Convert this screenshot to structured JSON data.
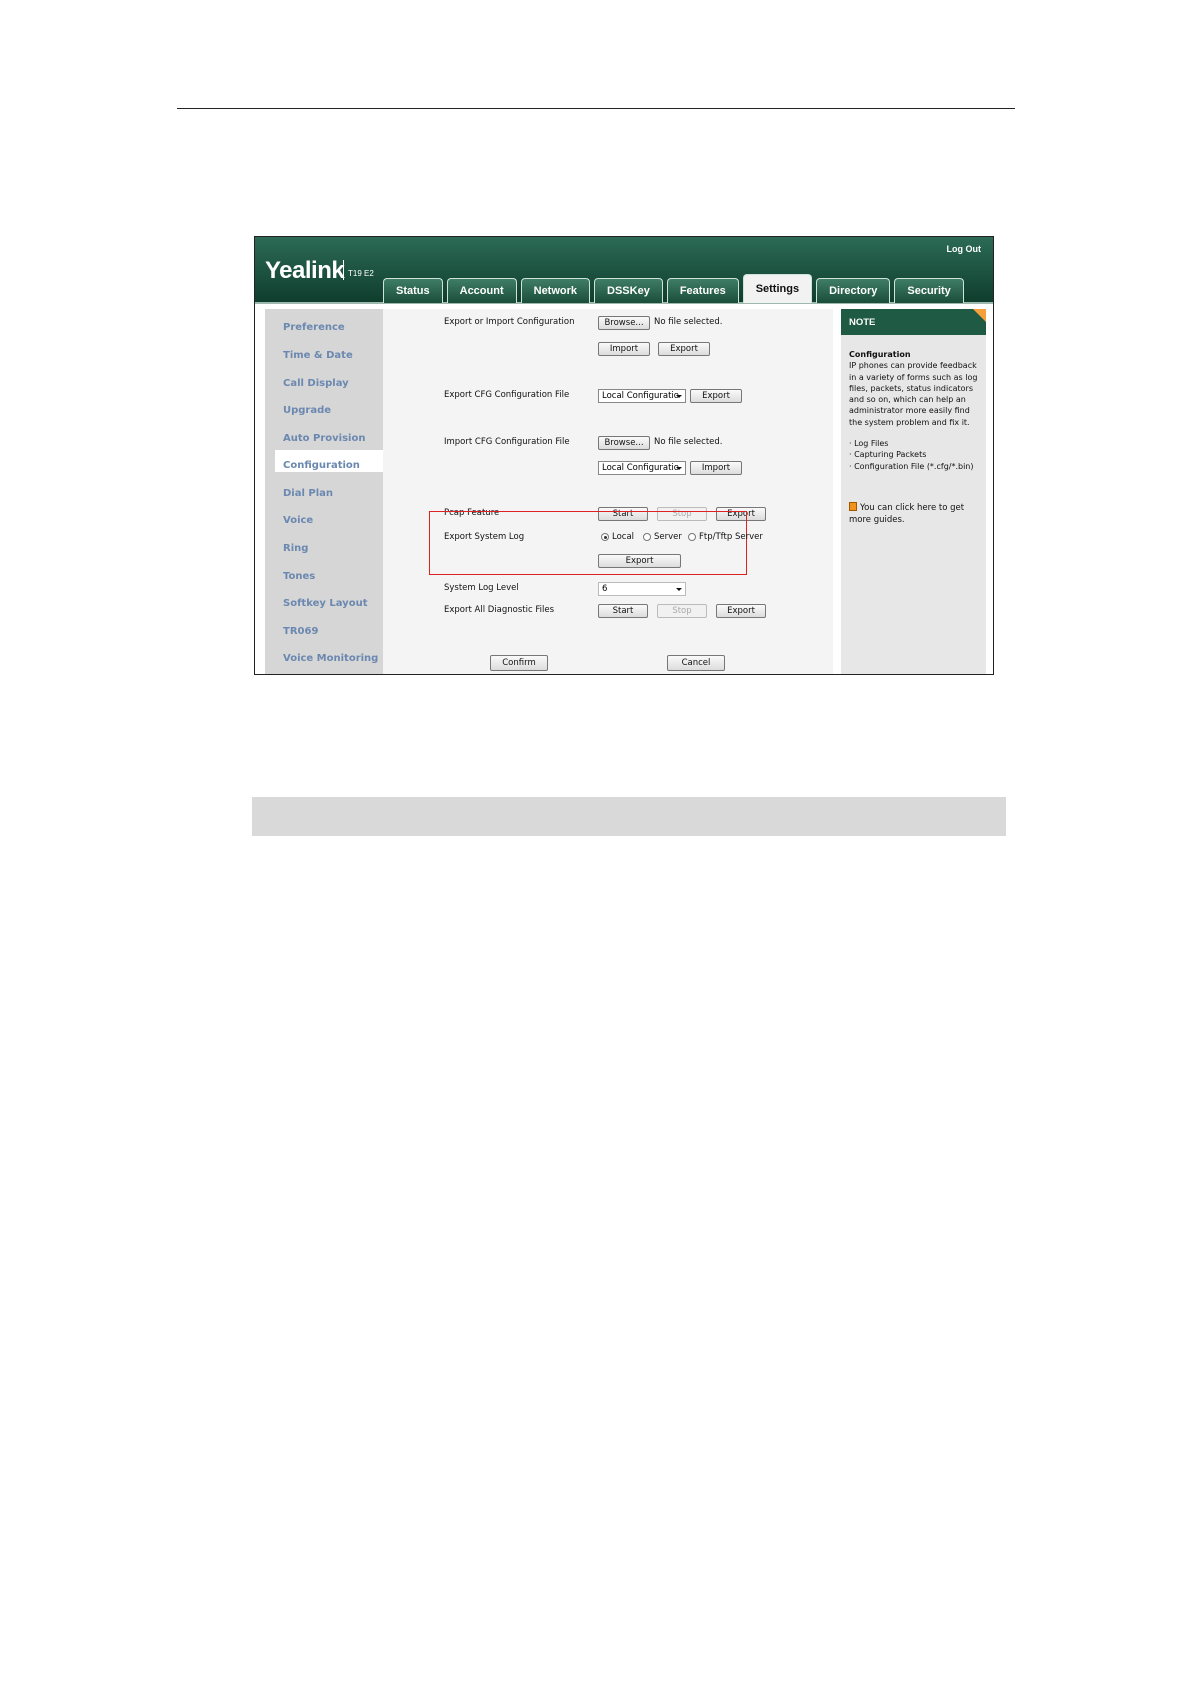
{
  "header": {
    "logo": "Yealink",
    "model": "T19 E2",
    "logout": "Log Out"
  },
  "tabs": [
    {
      "label": "Status"
    },
    {
      "label": "Account"
    },
    {
      "label": "Network"
    },
    {
      "label": "DSSKey"
    },
    {
      "label": "Features"
    },
    {
      "label": "Settings",
      "active": true
    },
    {
      "label": "Directory"
    },
    {
      "label": "Security"
    }
  ],
  "sidebar": {
    "items": [
      "Preference",
      "Time & Date",
      "Call Display",
      "Upgrade",
      "Auto Provision",
      "Configuration",
      "Dial Plan",
      "Voice",
      "Ring",
      "Tones",
      "Softkey Layout",
      "TR069",
      "Voice Monitoring"
    ],
    "active": "Configuration"
  },
  "main": {
    "export_import_config": {
      "label": "Export or Import Configuration",
      "browse": "Browse...",
      "file_status": "No file selected.",
      "import": "Import",
      "export": "Export"
    },
    "export_cfg": {
      "label": "Export CFG Configuration File",
      "select_value": "Local Configuratio",
      "export": "Export"
    },
    "import_cfg": {
      "label": "Import CFG Configuration File",
      "browse": "Browse...",
      "file_status": "No file selected.",
      "select_value": "Local Configuratio",
      "import": "Import"
    },
    "pcap": {
      "label": "Pcap Feature",
      "start": "Start",
      "stop": "Stop",
      "export": "Export"
    },
    "export_system_log": {
      "label": "Export System Log",
      "options": [
        "Local",
        "Server",
        "Ftp/Tftp Server"
      ],
      "selected": "Local",
      "export": "Export"
    },
    "system_log_level": {
      "label": "System Log Level",
      "value": "6"
    },
    "export_diagnostic": {
      "label": "Export All Diagnostic Files",
      "start": "Start",
      "stop": "Stop",
      "export": "Export"
    },
    "confirm": "Confirm",
    "cancel": "Cancel"
  },
  "note": {
    "header": "NOTE",
    "title": "Configuration",
    "text": "IP phones can provide feedback in a variety of forms such as log files, packets, status indicators and so on, which can help an administrator more easily find the system problem and fix it.",
    "bullets": [
      "· Log Files",
      "· Capturing Packets",
      "· Configuration File (*.cfg/*.bin)"
    ],
    "guide": "You can click here to get more guides."
  },
  "colors": {
    "header_green": "#1a4d3a",
    "sidebar_text": "#6b88b0",
    "highlight_red": "#dd2222",
    "note_icon": "#f1931b"
  }
}
